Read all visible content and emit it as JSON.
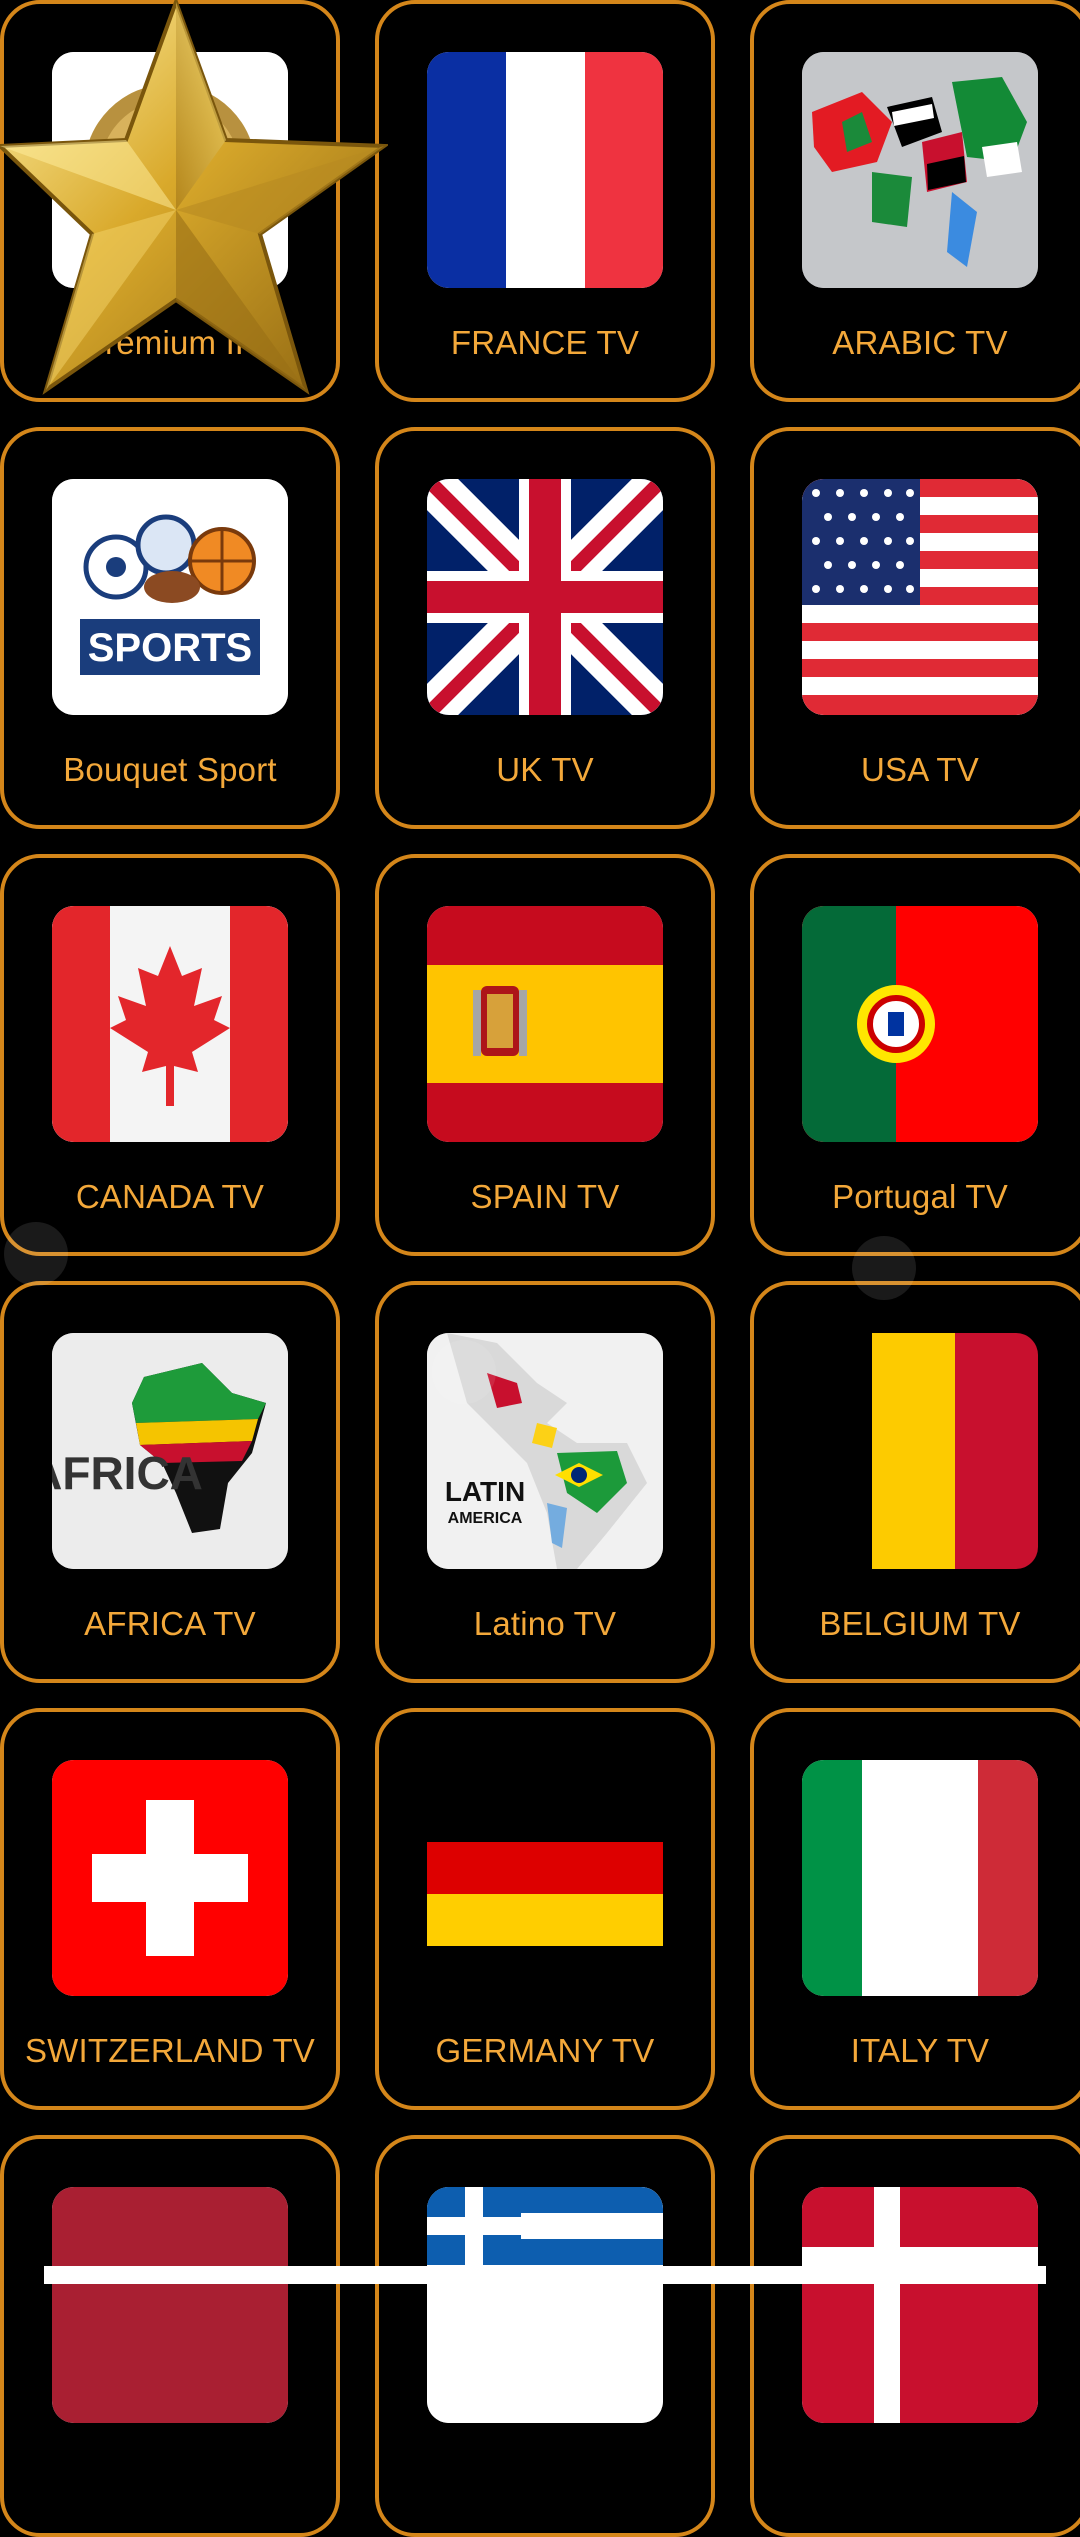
{
  "colors": {
    "accent": "#d4861a",
    "label": "#f3a83a",
    "background": "#000000"
  },
  "tiles": [
    {
      "label": "Premium IP",
      "icon": "premium-badge-icon"
    },
    {
      "label": "FRANCE TV",
      "icon": "france-flag-icon"
    },
    {
      "label": "ARABIC TV",
      "icon": "arab-world-map-icon"
    },
    {
      "label": "Bouquet Sport",
      "icon": "sports-balls-icon",
      "logo_text": "SPORTS"
    },
    {
      "label": "UK TV",
      "icon": "uk-flag-icon"
    },
    {
      "label": "USA TV",
      "icon": "usa-flag-icon"
    },
    {
      "label": "CANADA TV",
      "icon": "canada-flag-icon"
    },
    {
      "label": "SPAIN TV",
      "icon": "spain-flag-icon"
    },
    {
      "label": "Portugal TV",
      "icon": "portugal-flag-icon"
    },
    {
      "label": "AFRICA TV",
      "icon": "africa-map-icon",
      "logo_text": "AFRICA"
    },
    {
      "label": "Latino TV",
      "icon": "latin-america-map-icon",
      "logo_text": "LATIN",
      "logo_subtext": "AMERICA"
    },
    {
      "label": "BELGIUM TV",
      "icon": "belgium-flag-icon"
    },
    {
      "label": "SWITZERLAND TV",
      "icon": "switzerland-flag-icon"
    },
    {
      "label": "GERMANY TV",
      "icon": "germany-flag-icon"
    },
    {
      "label": "ITALY TV",
      "icon": "italy-flag-icon"
    },
    {
      "label": "",
      "icon": "red-flag-icon"
    },
    {
      "label": "",
      "icon": "greece-flag-icon"
    },
    {
      "label": "",
      "icon": "denmark-flag-icon"
    }
  ],
  "overlay": {
    "icon": "gold-star-icon"
  }
}
